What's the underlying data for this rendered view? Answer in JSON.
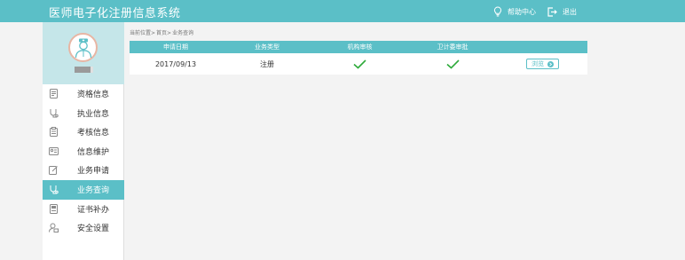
{
  "header": {
    "app_title": "医师电子化注册信息系统",
    "help_label": "帮助中心",
    "logout_label": "退出"
  },
  "sidebar": {
    "user_name": "",
    "items": [
      {
        "label": "资格信息",
        "icon": "document-icon"
      },
      {
        "label": "执业信息",
        "icon": "stethoscope-icon"
      },
      {
        "label": "考核信息",
        "icon": "clipboard-icon"
      },
      {
        "label": "信息维护",
        "icon": "id-card-icon"
      },
      {
        "label": "业务申请",
        "icon": "edit-icon"
      },
      {
        "label": "业务查询",
        "icon": "search-icon",
        "active": true
      },
      {
        "label": "证书补办",
        "icon": "certificate-icon"
      },
      {
        "label": "安全设置",
        "icon": "user-lock-icon"
      }
    ]
  },
  "breadcrumb": {
    "prefix": "当前位置>",
    "home": "首页>",
    "current": "业务查询"
  },
  "table": {
    "columns": [
      "申请日期",
      "业务类型",
      "机构审核",
      "卫计委审批",
      ""
    ],
    "rows": [
      {
        "date": "2017/09/13",
        "type": "注册",
        "org_review": "check-icon",
        "approval": "check-icon",
        "action_label": "浏览"
      }
    ]
  },
  "colors": {
    "accent": "#5bbfc7",
    "check": "#2eaa3a"
  }
}
